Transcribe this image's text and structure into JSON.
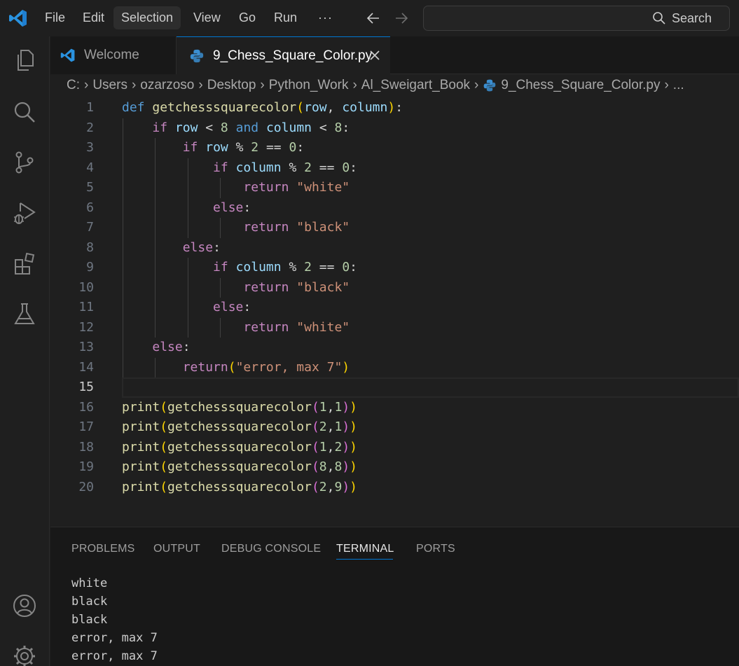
{
  "menu": {
    "file": "File",
    "edit": "Edit",
    "selection": "Selection",
    "view": "View",
    "go": "Go",
    "run": "Run",
    "more": "···"
  },
  "search": {
    "label": "Search"
  },
  "activity_bar": {
    "items": [
      "explorer-icon",
      "search-icon",
      "source-control-icon",
      "run-debug-icon",
      "extensions-icon",
      "testing-icon"
    ],
    "bottom": [
      "accounts-icon",
      "manage-gear-icon"
    ]
  },
  "tabs": [
    {
      "label": "Welcome",
      "active": false
    },
    {
      "label": "9_Chess_Square_Color.py",
      "active": true
    }
  ],
  "breadcrumb": [
    "C:",
    "Users",
    "ozarzoso",
    "Desktop",
    "Python_Work",
    "Al_Sweigart_Book",
    "9_Chess_Square_Color.py",
    "..."
  ],
  "editor": {
    "current_line": 15,
    "lines": [
      {
        "n": "1",
        "tokens": [
          [
            "kw",
            "def"
          ],
          [
            "op",
            " "
          ],
          [
            "fn",
            "getchesssquarecolor"
          ],
          [
            "br1",
            "("
          ],
          [
            "prm",
            "row"
          ],
          [
            "op",
            ", "
          ],
          [
            "prm",
            "column"
          ],
          [
            "br1",
            ")"
          ],
          [
            "op",
            ":"
          ]
        ]
      },
      {
        "n": "2",
        "tokens": [
          [
            "op",
            "    "
          ],
          [
            "ctl",
            "if"
          ],
          [
            "op",
            " "
          ],
          [
            "prm",
            "row"
          ],
          [
            "op",
            " < "
          ],
          [
            "num",
            "8"
          ],
          [
            "op",
            " "
          ],
          [
            "kw",
            "and"
          ],
          [
            "op",
            " "
          ],
          [
            "prm",
            "column"
          ],
          [
            "op",
            " < "
          ],
          [
            "num",
            "8"
          ],
          [
            "op",
            ":"
          ]
        ]
      },
      {
        "n": "3",
        "tokens": [
          [
            "op",
            "        "
          ],
          [
            "ctl",
            "if"
          ],
          [
            "op",
            " "
          ],
          [
            "prm",
            "row"
          ],
          [
            "op",
            " % "
          ],
          [
            "num",
            "2"
          ],
          [
            "op",
            " == "
          ],
          [
            "num",
            "0"
          ],
          [
            "op",
            ":"
          ]
        ]
      },
      {
        "n": "4",
        "tokens": [
          [
            "op",
            "            "
          ],
          [
            "ctl",
            "if"
          ],
          [
            "op",
            " "
          ],
          [
            "prm",
            "column"
          ],
          [
            "op",
            " % "
          ],
          [
            "num",
            "2"
          ],
          [
            "op",
            " == "
          ],
          [
            "num",
            "0"
          ],
          [
            "op",
            ":"
          ]
        ]
      },
      {
        "n": "5",
        "tokens": [
          [
            "op",
            "                "
          ],
          [
            "ctl",
            "return"
          ],
          [
            "op",
            " "
          ],
          [
            "str",
            "\"white\""
          ]
        ]
      },
      {
        "n": "6",
        "tokens": [
          [
            "op",
            "            "
          ],
          [
            "ctl",
            "else"
          ],
          [
            "op",
            ":"
          ]
        ]
      },
      {
        "n": "7",
        "tokens": [
          [
            "op",
            "                "
          ],
          [
            "ctl",
            "return"
          ],
          [
            "op",
            " "
          ],
          [
            "str",
            "\"black\""
          ]
        ]
      },
      {
        "n": "8",
        "tokens": [
          [
            "op",
            "        "
          ],
          [
            "ctl",
            "else"
          ],
          [
            "op",
            ":"
          ]
        ]
      },
      {
        "n": "9",
        "tokens": [
          [
            "op",
            "            "
          ],
          [
            "ctl",
            "if"
          ],
          [
            "op",
            " "
          ],
          [
            "prm",
            "column"
          ],
          [
            "op",
            " % "
          ],
          [
            "num",
            "2"
          ],
          [
            "op",
            " == "
          ],
          [
            "num",
            "0"
          ],
          [
            "op",
            ":"
          ]
        ]
      },
      {
        "n": "10",
        "tokens": [
          [
            "op",
            "                "
          ],
          [
            "ctl",
            "return"
          ],
          [
            "op",
            " "
          ],
          [
            "str",
            "\"black\""
          ]
        ]
      },
      {
        "n": "11",
        "tokens": [
          [
            "op",
            "            "
          ],
          [
            "ctl",
            "else"
          ],
          [
            "op",
            ":"
          ]
        ]
      },
      {
        "n": "12",
        "tokens": [
          [
            "op",
            "                "
          ],
          [
            "ctl",
            "return"
          ],
          [
            "op",
            " "
          ],
          [
            "str",
            "\"white\""
          ]
        ]
      },
      {
        "n": "13",
        "tokens": [
          [
            "op",
            "    "
          ],
          [
            "ctl",
            "else"
          ],
          [
            "op",
            ":"
          ]
        ]
      },
      {
        "n": "14",
        "tokens": [
          [
            "op",
            "        "
          ],
          [
            "ctl",
            "return"
          ],
          [
            "br1",
            "("
          ],
          [
            "str",
            "\"error, max 7\""
          ],
          [
            "br1",
            ")"
          ]
        ]
      },
      {
        "n": "15",
        "tokens": []
      },
      {
        "n": "16",
        "tokens": [
          [
            "fn",
            "print"
          ],
          [
            "br1",
            "("
          ],
          [
            "fn",
            "getchesssquarecolor"
          ],
          [
            "br2",
            "("
          ],
          [
            "num",
            "1"
          ],
          [
            "op",
            ","
          ],
          [
            "num",
            "1"
          ],
          [
            "br2",
            ")"
          ],
          [
            "br1",
            ")"
          ]
        ]
      },
      {
        "n": "17",
        "tokens": [
          [
            "fn",
            "print"
          ],
          [
            "br1",
            "("
          ],
          [
            "fn",
            "getchesssquarecolor"
          ],
          [
            "br2",
            "("
          ],
          [
            "num",
            "2"
          ],
          [
            "op",
            ","
          ],
          [
            "num",
            "1"
          ],
          [
            "br2",
            ")"
          ],
          [
            "br1",
            ")"
          ]
        ]
      },
      {
        "n": "18",
        "tokens": [
          [
            "fn",
            "print"
          ],
          [
            "br1",
            "("
          ],
          [
            "fn",
            "getchesssquarecolor"
          ],
          [
            "br2",
            "("
          ],
          [
            "num",
            "1"
          ],
          [
            "op",
            ","
          ],
          [
            "num",
            "2"
          ],
          [
            "br2",
            ")"
          ],
          [
            "br1",
            ")"
          ]
        ]
      },
      {
        "n": "19",
        "tokens": [
          [
            "fn",
            "print"
          ],
          [
            "br1",
            "("
          ],
          [
            "fn",
            "getchesssquarecolor"
          ],
          [
            "br2",
            "("
          ],
          [
            "num",
            "8"
          ],
          [
            "op",
            ","
          ],
          [
            "num",
            "8"
          ],
          [
            "br2",
            ")"
          ],
          [
            "br1",
            ")"
          ]
        ]
      },
      {
        "n": "20",
        "tokens": [
          [
            "fn",
            "print"
          ],
          [
            "br1",
            "("
          ],
          [
            "fn",
            "getchesssquarecolor"
          ],
          [
            "br2",
            "("
          ],
          [
            "num",
            "2"
          ],
          [
            "op",
            ","
          ],
          [
            "num",
            "9"
          ],
          [
            "br2",
            ")"
          ],
          [
            "br1",
            ")"
          ]
        ]
      }
    ]
  },
  "panel": {
    "tabs": [
      "PROBLEMS",
      "OUTPUT",
      "DEBUG CONSOLE",
      "TERMINAL",
      "PORTS"
    ],
    "active_tab": "TERMINAL",
    "terminal_lines": [
      "white",
      "black",
      "black",
      "error, max 7",
      "error, max 7"
    ]
  },
  "colors": {
    "accent": "#0078d4",
    "keyword": "#569cd6",
    "control": "#c586c0",
    "function": "#dcdcaa",
    "parameter": "#9cdcfe",
    "number": "#b5cea8",
    "string": "#ce9178",
    "bracket_1": "#ffd700",
    "bracket_2": "#da70d6"
  }
}
